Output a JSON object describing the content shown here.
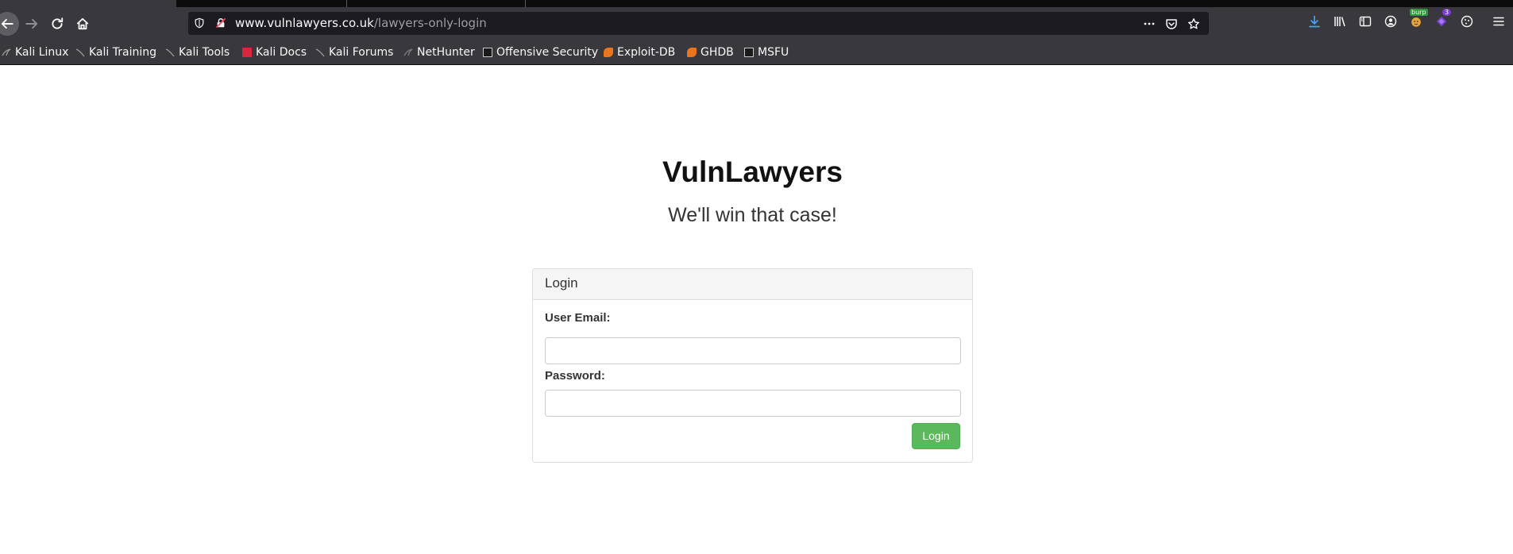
{
  "browser": {
    "url_domain": "www.vulnlawyers.co.uk",
    "url_path": "/lawyers-only-login",
    "container_badge": "burp",
    "extension_badge": "3"
  },
  "bookmarks": [
    {
      "label": "Kali Linux",
      "icon": "kali-dragon-icon"
    },
    {
      "label": "Kali Training",
      "icon": "kali-dragon-icon"
    },
    {
      "label": "Kali Tools",
      "icon": "kali-dragon-icon"
    },
    {
      "label": "Kali Docs",
      "icon": "kali-docs-icon"
    },
    {
      "label": "Kali Forums",
      "icon": "kali-dragon-icon"
    },
    {
      "label": "NetHunter",
      "icon": "nethunter-icon"
    },
    {
      "label": "Offensive Security",
      "icon": "offsec-icon"
    },
    {
      "label": "Exploit-DB",
      "icon": "exploitdb-icon"
    },
    {
      "label": "GHDB",
      "icon": "exploitdb-icon"
    },
    {
      "label": "MSFU",
      "icon": "offsec-icon"
    }
  ],
  "page": {
    "title": "VulnLawyers",
    "subtitle": "We'll win that case!"
  },
  "login_panel": {
    "heading": "Login",
    "email_label": "User Email:",
    "email_value": "",
    "password_label": "Password:",
    "password_value": "",
    "submit_label": "Login"
  },
  "colors": {
    "chrome_bg": "#38383d",
    "urlbar_bg": "#1c1b22",
    "button_green": "#5cb85c",
    "download_blue": "#45a1ff"
  }
}
